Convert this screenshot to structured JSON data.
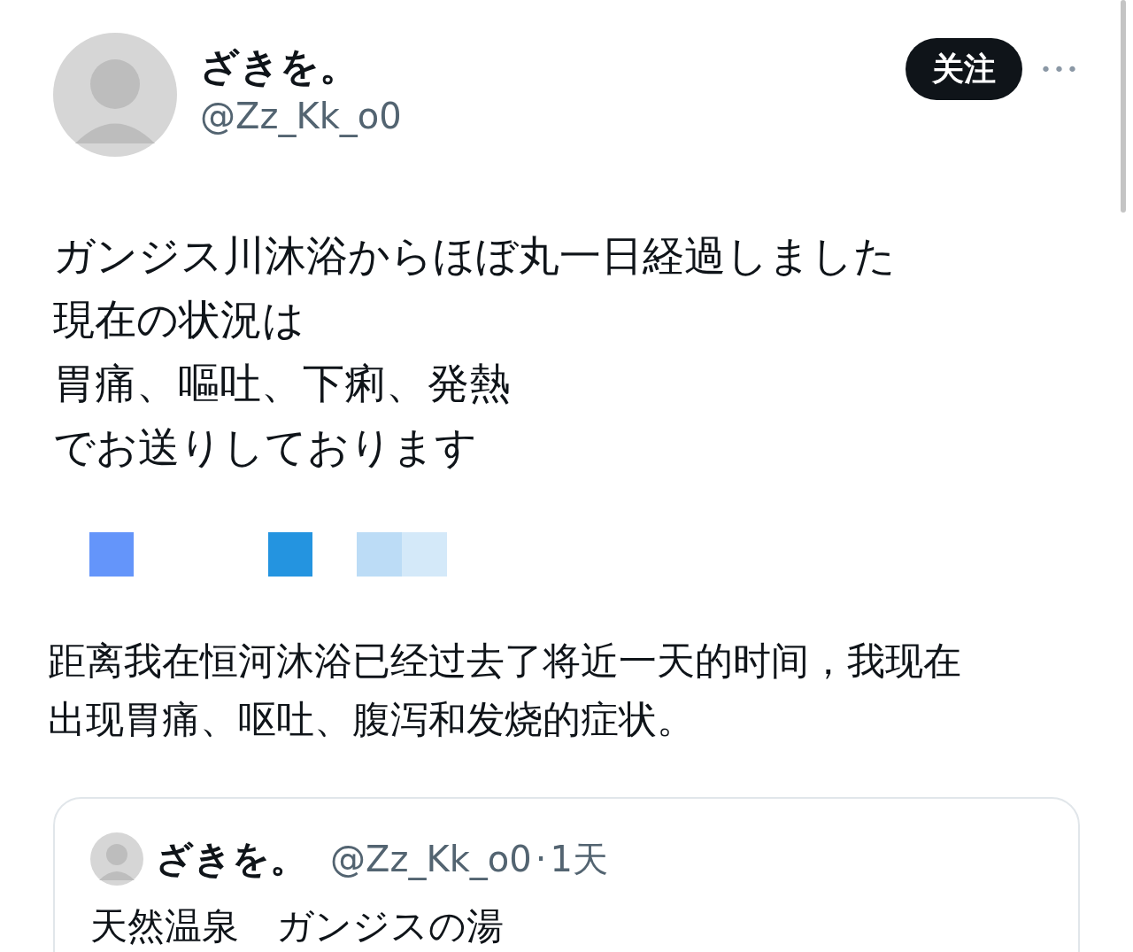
{
  "author": {
    "name": "ざきを。",
    "handle": "@Zz_Kk_o0"
  },
  "follow_button": {
    "label": "关注"
  },
  "more_button": {
    "label": "•••"
  },
  "tweet_text": [
    "ガンジス川沐浴からほぼ丸一日経過しました",
    "現在の状況は",
    "胃痛、嘔吐、下痢、発熱",
    "でお送りしております"
  ],
  "translation": [
    "距离我在恒河沐浴已经过去了将近一天的时间，我现在",
    "出现胃痛、呕吐、腹泻和发烧的症状。"
  ],
  "quoted_tweet": {
    "name": "ざきを。",
    "handle": "@Zz_Kk_o0",
    "separator": "·",
    "time": "1天",
    "text": "天然温泉　ガンジスの湯"
  }
}
